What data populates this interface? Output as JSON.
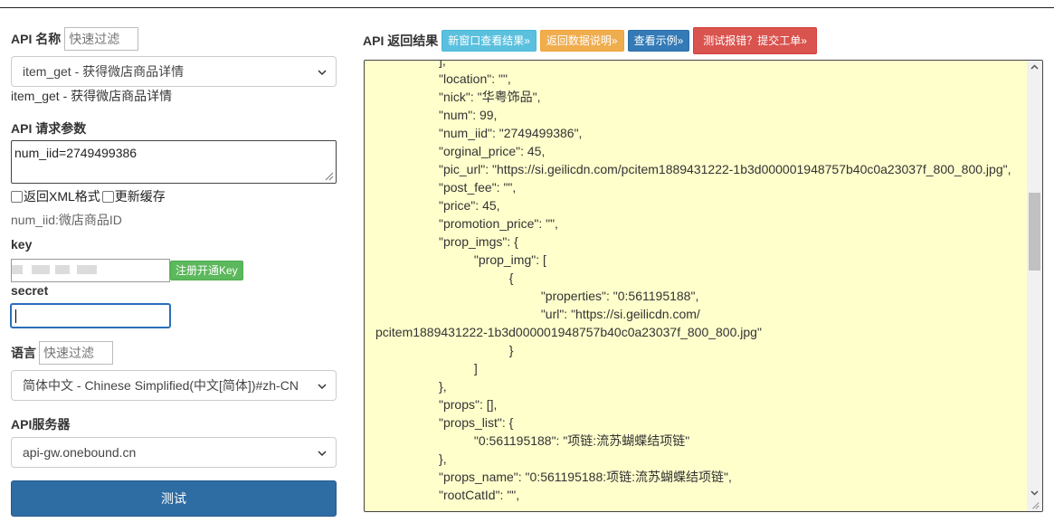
{
  "left": {
    "api_name_label": "API 名称",
    "api_name_filter_placeholder": "快速过滤",
    "api_select_value": "item_get - 获得微店商品详情",
    "api_description": "item_get - 获得微店商品详情",
    "params_label": "API 请求参数",
    "params_value": "num_iid=2749499386",
    "xml_checkbox_label": "返回XML格式",
    "cache_checkbox_label": "更新缓存",
    "param_hint": "num_iid:微店商品ID",
    "key_label": "key",
    "register_key_button": "注册开通Key",
    "secret_label": "secret",
    "language_label": "语言",
    "language_filter_placeholder": "快速过滤",
    "language_select_value": "简体中文 - Chinese Simplified(中文[简体])#zh-CN",
    "server_label": "API服务器",
    "server_select_value": "api-gw.onebound.cn",
    "test_button": "测试"
  },
  "right": {
    "result_label": "API 返回结果",
    "buttons": {
      "new_window": "新窗口查看结果»",
      "return_doc": "返回数据说明»",
      "view_example": "查看示例»",
      "report_error": "测试报错？提交工单»"
    },
    "result_lines": [
      "                  ],",
      "                  \"location\": \"\",",
      "                  \"nick\": \"华粤饰品\",",
      "                  \"num\": 99,",
      "                  \"num_iid\": \"2749499386\",",
      "                  \"orginal_price\": 45,",
      "                  \"pic_url\": \"https://si.geilicdn.com/pcitem1889431222-1b3d000001948757b40c0a23037f_800_800.jpg\",",
      "                  \"post_fee\": \"\",",
      "                  \"price\": 45,",
      "                  \"promotion_price\": \"\",",
      "                  \"prop_imgs\": {",
      "                            \"prop_img\": [",
      "                                      {",
      "                                               \"properties\": \"0:561195188\",",
      "                                               \"url\": \"https://si.geilicdn.com/",
      "pcitem1889431222-1b3d000001948757b40c0a23037f_800_800.jpg\"",
      "                                      }",
      "                            ]",
      "                  },",
      "                  \"props\": [],",
      "                  \"props_list\": {",
      "                            \"0:561195188\": \"项链:流苏蝴蝶结项链\"",
      "                  },",
      "                  \"props_name\": \"0:561195188:项链:流苏蝴蝶结项链\",",
      "                  \"rootCatId\": \"\","
    ]
  },
  "icons": [
    "chevron-down-icon",
    "resize-grip-icon",
    "scroll-up-arrow-icon",
    "scroll-down-arrow-icon"
  ]
}
